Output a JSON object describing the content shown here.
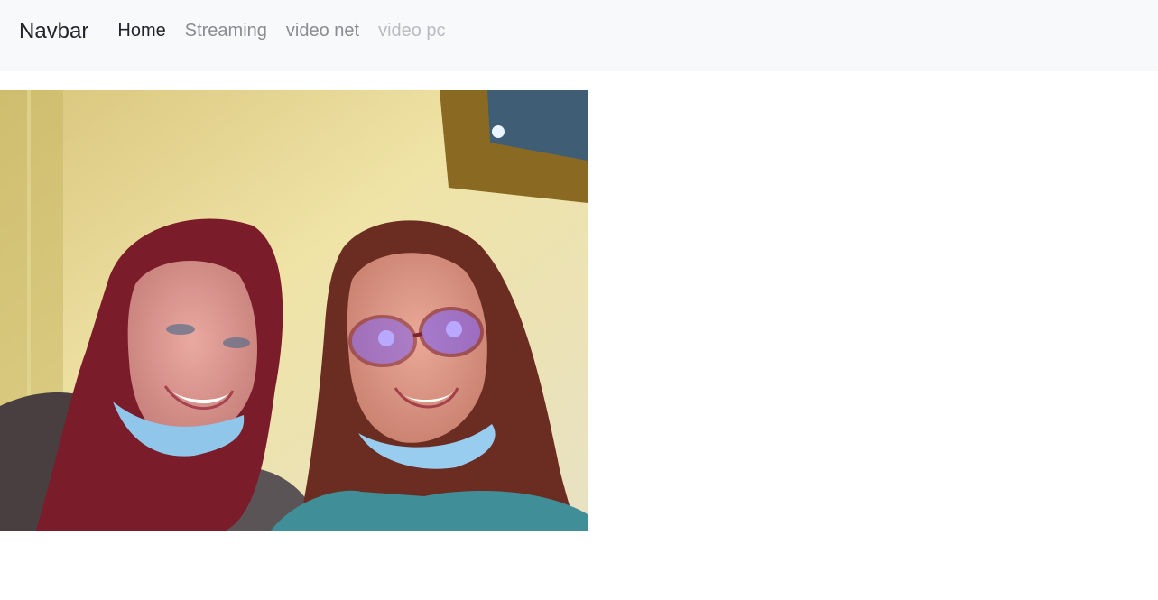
{
  "navbar": {
    "brand": "Navbar",
    "links": [
      {
        "label": "Home",
        "state": "active"
      },
      {
        "label": "Streaming",
        "state": "normal"
      },
      {
        "label": "video net",
        "state": "normal"
      },
      {
        "label": "video pc",
        "state": "disabled"
      }
    ]
  },
  "video": {
    "kind": "webcam-stream",
    "description": "Two smiling people wearing face masks pulled down under their chins in a room with a yellow wall"
  },
  "colors": {
    "navbar_bg": "#f8f9fa",
    "link_active": "#212529",
    "link_normal": "#8a8c8f",
    "link_disabled": "#b9bbbe"
  }
}
